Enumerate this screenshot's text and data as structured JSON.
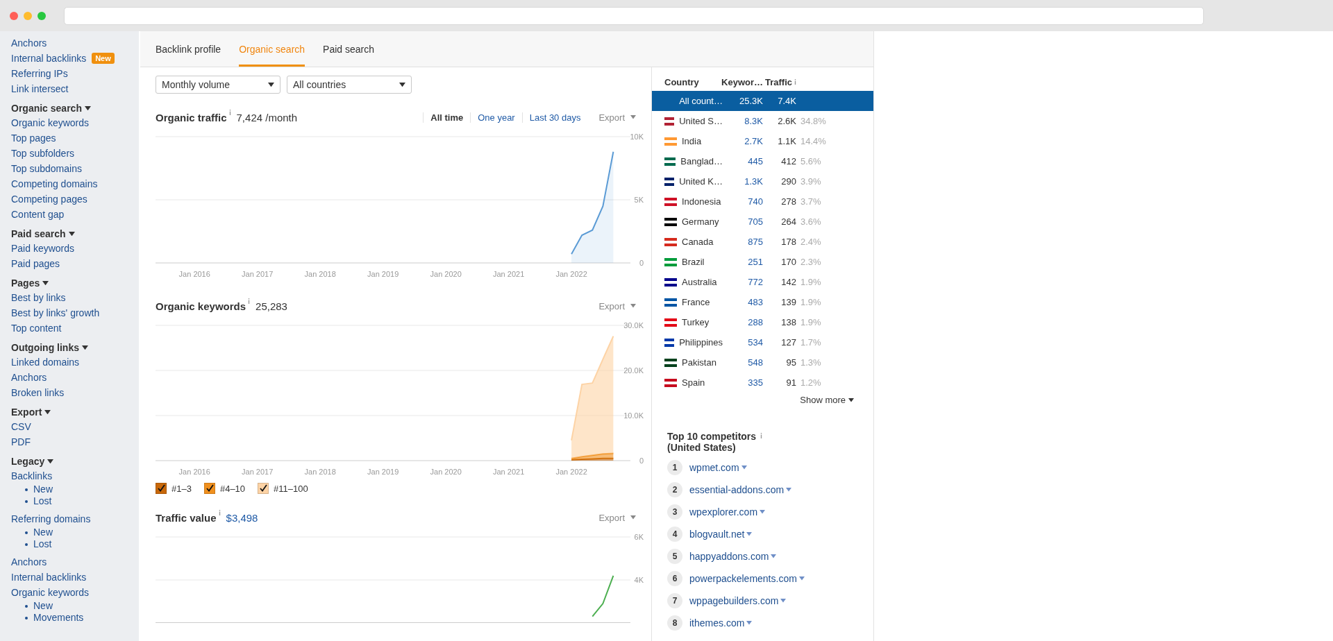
{
  "sidebar": {
    "sections": [
      {
        "items": [
          {
            "label": "Anchors"
          },
          {
            "label": "Internal backlinks",
            "badge": "New"
          },
          {
            "label": "Referring IPs"
          },
          {
            "label": "Link intersect"
          }
        ]
      },
      {
        "title": "Organic search",
        "items": [
          {
            "label": "Organic keywords"
          },
          {
            "label": "Top pages"
          },
          {
            "label": "Top subfolders"
          },
          {
            "label": "Top subdomains"
          },
          {
            "label": "Competing domains"
          },
          {
            "label": "Competing pages"
          },
          {
            "label": "Content gap"
          }
        ]
      },
      {
        "title": "Paid search",
        "items": [
          {
            "label": "Paid keywords"
          },
          {
            "label": "Paid pages"
          }
        ]
      },
      {
        "title": "Pages",
        "items": [
          {
            "label": "Best by links"
          },
          {
            "label": "Best by links' growth"
          },
          {
            "label": "Top content"
          }
        ]
      },
      {
        "title": "Outgoing links",
        "items": [
          {
            "label": "Linked domains"
          },
          {
            "label": "Anchors"
          },
          {
            "label": "Broken links"
          }
        ]
      },
      {
        "title": "Export",
        "items": [
          {
            "label": "CSV"
          },
          {
            "label": "PDF"
          }
        ]
      },
      {
        "title": "Legacy",
        "items": [
          {
            "label": "Backlinks",
            "children": [
              {
                "label": "New"
              },
              {
                "label": "Lost"
              }
            ]
          },
          {
            "label": "Referring domains",
            "children": [
              {
                "label": "New"
              },
              {
                "label": "Lost"
              }
            ]
          },
          {
            "label": "Anchors"
          },
          {
            "label": "Internal backlinks"
          },
          {
            "label": "Organic keywords",
            "children": [
              {
                "label": "New"
              },
              {
                "label": "Movements"
              }
            ]
          }
        ]
      }
    ]
  },
  "tabs": [
    {
      "label": "Backlink profile",
      "selected": false
    },
    {
      "label": "Organic search",
      "selected": true
    },
    {
      "label": "Paid search",
      "selected": false
    }
  ],
  "filters": [
    {
      "value": "Monthly volume"
    },
    {
      "value": "All countries"
    }
  ],
  "charts": [
    {
      "title": "Organic traffic",
      "value": "7,424 /month",
      "value_link": false,
      "ranges": [
        {
          "label": "All time",
          "selected": true
        },
        {
          "label": "One year",
          "selected": false
        },
        {
          "label": "Last 30 days",
          "selected": false
        }
      ],
      "export": "Export",
      "chart_data": {
        "type": "area",
        "categories": [
          null,
          null,
          null,
          "Jan 2016",
          null,
          null,
          null,
          null,
          null,
          "Jan 2017",
          null,
          null,
          null,
          null,
          null,
          "Jan 2018",
          null,
          null,
          null,
          null,
          null,
          "Jan 2019",
          null,
          null,
          null,
          null,
          null,
          "Jan 2020",
          null,
          null,
          null,
          null,
          null,
          "Jan 2021",
          null,
          null,
          null,
          null,
          null,
          "Jan 2022",
          null,
          null,
          null,
          null
        ],
        "series": [
          {
            "color": "#5b9bd5",
            "values": [
              null,
              null,
              null,
              null,
              null,
              null,
              null,
              null,
              null,
              null,
              null,
              null,
              null,
              null,
              null,
              null,
              null,
              null,
              null,
              null,
              null,
              null,
              null,
              null,
              null,
              null,
              null,
              null,
              null,
              null,
              null,
              null,
              null,
              null,
              null,
              null,
              null,
              null,
              null,
              700,
              2200,
              2600,
              4500,
              8800
            ]
          }
        ],
        "ylim": [
          0,
          10000
        ],
        "yticks": [
          {
            "value": 0,
            "label": "0"
          },
          {
            "value": 5000,
            "label": "5K"
          },
          {
            "value": 10000,
            "label": "10K"
          }
        ]
      }
    },
    {
      "title": "Organic keywords",
      "value": "25,283",
      "value_link": false,
      "export": "Export",
      "legend": [
        {
          "checked": true
        },
        {
          "checked": true
        },
        {
          "checked": true
        }
      ],
      "chart_data": {
        "type": "area",
        "stacked": true,
        "categories": [
          null,
          null,
          null,
          "Jan 2016",
          null,
          null,
          null,
          null,
          null,
          "Jan 2017",
          null,
          null,
          null,
          null,
          null,
          "Jan 2018",
          null,
          null,
          null,
          null,
          null,
          "Jan 2019",
          null,
          null,
          null,
          null,
          null,
          "Jan 2020",
          null,
          null,
          null,
          null,
          null,
          "Jan 2021",
          null,
          null,
          null,
          null,
          null,
          "Jan 2022",
          null,
          null,
          null,
          null
        ],
        "series": [
          {
            "name": "#1–3",
            "color": "#c8680a",
            "values": [
              null,
              null,
              null,
              null,
              null,
              null,
              null,
              null,
              null,
              null,
              null,
              null,
              null,
              null,
              null,
              null,
              null,
              null,
              null,
              null,
              null,
              null,
              null,
              null,
              null,
              null,
              null,
              null,
              null,
              null,
              null,
              null,
              null,
              null,
              null,
              null,
              null,
              null,
              null,
              200,
              300,
              400,
              500,
              500
            ]
          },
          {
            "name": "#4–10",
            "color": "#f0901e",
            "values": [
              null,
              null,
              null,
              null,
              null,
              null,
              null,
              null,
              null,
              null,
              null,
              null,
              null,
              null,
              null,
              null,
              null,
              null,
              null,
              null,
              null,
              null,
              null,
              null,
              null,
              null,
              null,
              null,
              null,
              null,
              null,
              null,
              null,
              null,
              null,
              null,
              null,
              null,
              null,
              300,
              600,
              800,
              1000,
              1100
            ]
          },
          {
            "name": "#11–100",
            "color": "#fdd3a5",
            "values": [
              null,
              null,
              null,
              null,
              null,
              null,
              null,
              null,
              null,
              null,
              null,
              null,
              null,
              null,
              null,
              null,
              null,
              null,
              null,
              null,
              null,
              null,
              null,
              null,
              null,
              null,
              null,
              null,
              null,
              null,
              null,
              null,
              null,
              null,
              null,
              null,
              null,
              null,
              null,
              4000,
              16000,
              16000,
              21000,
              26000
            ]
          }
        ],
        "ylim": [
          0,
          30000
        ],
        "yticks": [
          {
            "value": 0,
            "label": "0"
          },
          {
            "value": 10000,
            "label": "10.0K"
          },
          {
            "value": 20000,
            "label": "20.0K"
          },
          {
            "value": 30000,
            "label": "30.0K"
          }
        ]
      }
    },
    {
      "title": "Traffic value",
      "value": "$3,498",
      "value_link": true,
      "export": "Export",
      "chart_data": {
        "type": "line",
        "categories": [
          null,
          null,
          null,
          null,
          null,
          null,
          null,
          null,
          null,
          null,
          null,
          null,
          null,
          null,
          null,
          null,
          null,
          null,
          null,
          null,
          null,
          null,
          null,
          null,
          null,
          null,
          null,
          null,
          null,
          null,
          null,
          null,
          null,
          null,
          null,
          null,
          null,
          null,
          null,
          null,
          null,
          null,
          null,
          null
        ],
        "series": [
          {
            "color": "#4caf50",
            "values": [
              null,
              null,
              null,
              null,
              null,
              null,
              null,
              null,
              null,
              null,
              null,
              null,
              null,
              null,
              null,
              null,
              null,
              null,
              null,
              null,
              null,
              null,
              null,
              null,
              null,
              null,
              null,
              null,
              null,
              null,
              null,
              null,
              null,
              null,
              null,
              null,
              null,
              null,
              null,
              null,
              null,
              2300,
              2900,
              4200
            ]
          }
        ],
        "ylim": [
          2000,
          6000
        ],
        "yticks": [
          {
            "value": 4000,
            "label": "4K"
          },
          {
            "value": 6000,
            "label": "6K"
          }
        ]
      }
    }
  ],
  "countries": {
    "columns": [
      "Country",
      "Keywor…",
      "Traffic"
    ],
    "rows": [
      {
        "country": "All count…",
        "keywords": "25.3K",
        "traffic": "7.4K",
        "selected": true
      },
      {
        "country": "United S…",
        "keywords": "8.3K",
        "traffic": "2.6K",
        "share": "34.8%",
        "color": "#b22234",
        "selected": false
      },
      {
        "country": "India",
        "keywords": "2.7K",
        "traffic": "1.1K",
        "share": "14.4%",
        "color": "#ff9933",
        "selected": false
      },
      {
        "country": "Banglad…",
        "keywords": "445",
        "traffic": "412",
        "share": "5.6%",
        "color": "#006a4e",
        "selected": false
      },
      {
        "country": "United K…",
        "keywords": "1.3K",
        "traffic": "290",
        "share": "3.9%",
        "color": "#012169",
        "selected": false
      },
      {
        "country": "Indonesia",
        "keywords": "740",
        "traffic": "278",
        "share": "3.7%",
        "color": "#ce1126",
        "selected": false
      },
      {
        "country": "Germany",
        "keywords": "705",
        "traffic": "264",
        "share": "3.6%",
        "color": "#000000",
        "selected": false
      },
      {
        "country": "Canada",
        "keywords": "875",
        "traffic": "178",
        "share": "2.4%",
        "color": "#d52b1e",
        "selected": false
      },
      {
        "country": "Brazil",
        "keywords": "251",
        "traffic": "170",
        "share": "2.3%",
        "color": "#009c3b",
        "selected": false
      },
      {
        "country": "Australia",
        "keywords": "772",
        "traffic": "142",
        "share": "1.9%",
        "color": "#00008b",
        "selected": false
      },
      {
        "country": "France",
        "keywords": "483",
        "traffic": "139",
        "share": "1.9%",
        "color": "#0055a4",
        "selected": false
      },
      {
        "country": "Turkey",
        "keywords": "288",
        "traffic": "138",
        "share": "1.9%",
        "color": "#e30a17",
        "selected": false
      },
      {
        "country": "Philippines",
        "keywords": "534",
        "traffic": "127",
        "share": "1.7%",
        "color": "#0038a8",
        "selected": false
      },
      {
        "country": "Pakistan",
        "keywords": "548",
        "traffic": "95",
        "share": "1.3%",
        "color": "#01411c",
        "selected": false
      },
      {
        "country": "Spain",
        "keywords": "335",
        "traffic": "91",
        "share": "1.2%",
        "color": "#c60b1e",
        "selected": false
      }
    ],
    "show_more": "Show more"
  },
  "competitors": {
    "title": [
      "Top 10 competitors",
      "(United States)"
    ],
    "items": [
      {
        "rank": "1",
        "domain": "wpmet.com"
      },
      {
        "rank": "2",
        "domain": "essential-addons.com"
      },
      {
        "rank": "3",
        "domain": "wpexplorer.com"
      },
      {
        "rank": "4",
        "domain": "blogvault.net"
      },
      {
        "rank": "5",
        "domain": "happyaddons.com"
      },
      {
        "rank": "6",
        "domain": "powerpackelements.com"
      },
      {
        "rank": "7",
        "domain": "wppagebuilders.com"
      },
      {
        "rank": "8",
        "domain": "ithemes.com"
      }
    ]
  }
}
